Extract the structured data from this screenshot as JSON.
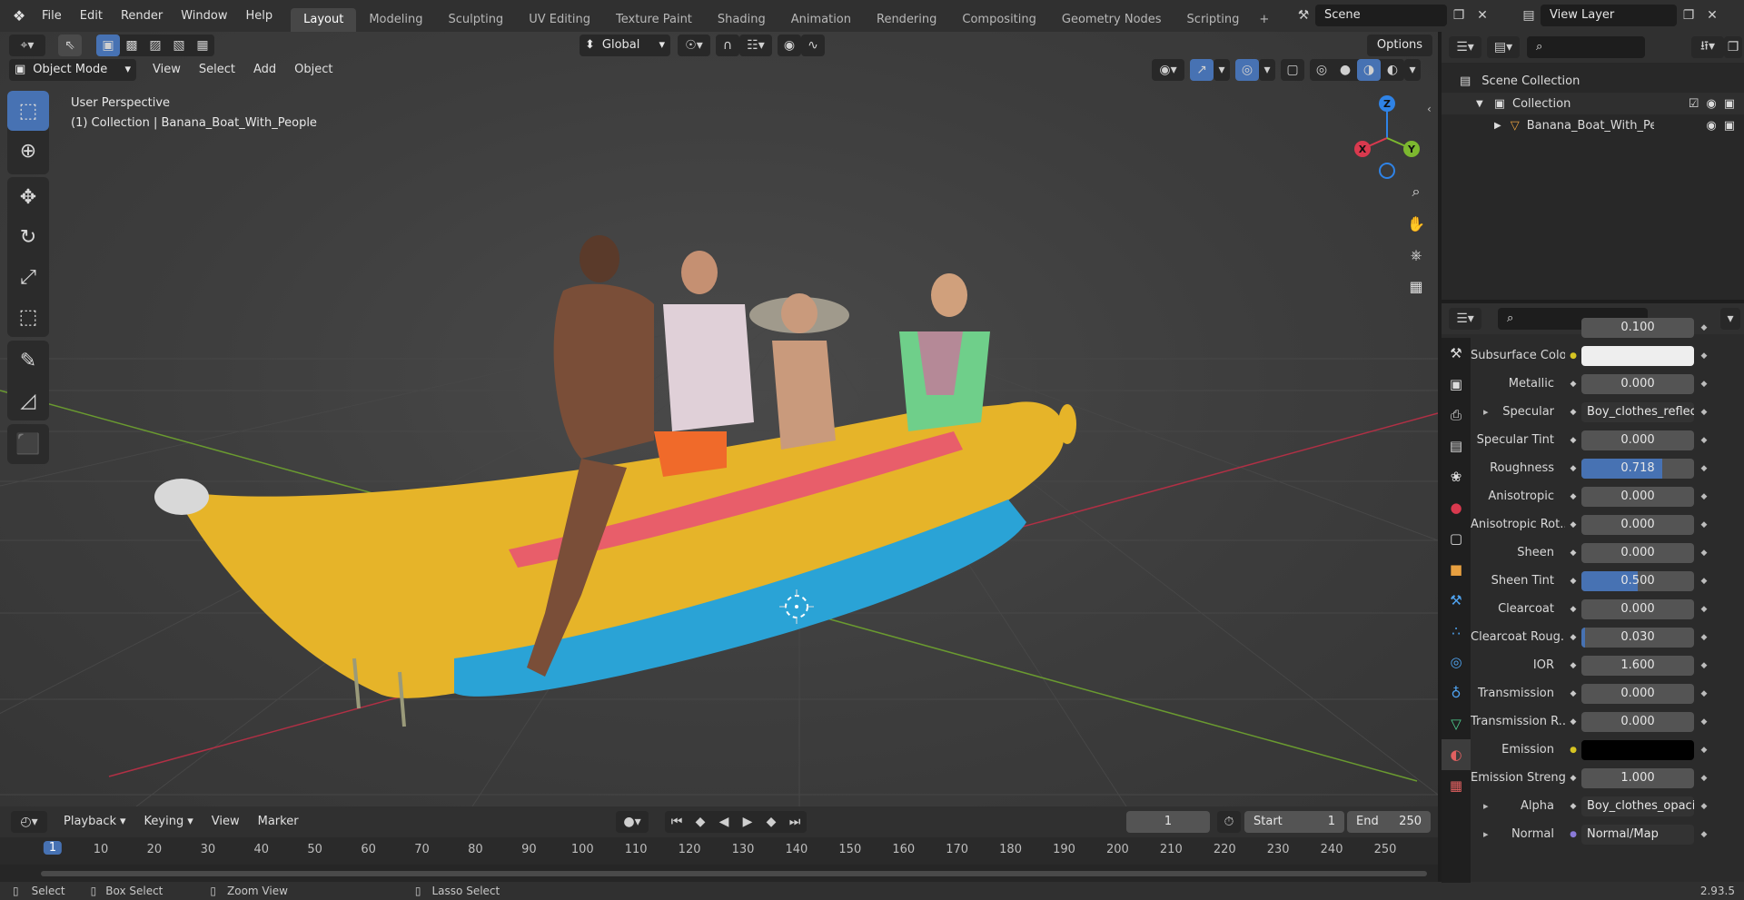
{
  "menubar": {
    "blender_icon": "blender-logo-icon",
    "items": [
      "File",
      "Edit",
      "Render",
      "Window",
      "Help"
    ],
    "workspaces": [
      "Layout",
      "Modeling",
      "Sculpting",
      "UV Editing",
      "Texture Paint",
      "Shading",
      "Animation",
      "Rendering",
      "Compositing",
      "Geometry Nodes",
      "Scripting"
    ],
    "active_workspace": "Layout",
    "add_tab": "+",
    "scene": "Scene",
    "view_layer": "View Layer"
  },
  "viewport": {
    "orientation": "Global",
    "options": "Options",
    "mode": "Object Mode",
    "menus": [
      "View",
      "Select",
      "Add",
      "Object"
    ],
    "perspective": "User Perspective",
    "collection_info": "(1) Collection | Banana_Boat_With_People",
    "gizmo": {
      "x": "X",
      "y": "Y",
      "z": "Z"
    }
  },
  "timeline": {
    "menus": [
      "Playback",
      "Keying",
      "View",
      "Marker"
    ],
    "current_frame": "1",
    "start_label": "Start",
    "start": "1",
    "end_label": "End",
    "end": "250",
    "ruler": [
      "1",
      "10",
      "20",
      "30",
      "40",
      "50",
      "60",
      "70",
      "80",
      "90",
      "100",
      "110",
      "120",
      "130",
      "140",
      "150",
      "160",
      "170",
      "180",
      "190",
      "200",
      "210",
      "220",
      "230",
      "240",
      "250"
    ]
  },
  "statusbar": {
    "select": "Select",
    "box_select": "Box Select",
    "zoom_view": "Zoom View",
    "lasso_select": "Lasso Select",
    "version": "2.93.5"
  },
  "outliner": {
    "root": "Scene Collection",
    "collection": "Collection",
    "object": "Banana_Boat_With_Peop"
  },
  "properties": {
    "top_value": "0.100",
    "rows": [
      {
        "label": "Subsurface Color",
        "type": "color",
        "color": "#eeeeee",
        "dot": "yellow"
      },
      {
        "label": "Metallic",
        "value": "0.000",
        "fill": 0
      },
      {
        "label": "Specular",
        "value": "Boy_clothes_reflecti...",
        "type": "link",
        "expand": true
      },
      {
        "label": "Specular Tint",
        "value": "0.000",
        "fill": 0
      },
      {
        "label": "Roughness",
        "value": "0.718",
        "fill": 0.718
      },
      {
        "label": "Anisotropic",
        "value": "0.000",
        "fill": 0
      },
      {
        "label": "Anisotropic Rot...",
        "value": "0.000",
        "fill": 0
      },
      {
        "label": "Sheen",
        "value": "0.000",
        "fill": 0
      },
      {
        "label": "Sheen Tint",
        "value": "0.500",
        "fill": 0.5
      },
      {
        "label": "Clearcoat",
        "value": "0.000",
        "fill": 0
      },
      {
        "label": "Clearcoat Roug...",
        "value": "0.030",
        "fill": 0.03
      },
      {
        "label": "IOR",
        "value": "1.600",
        "fill": 0
      },
      {
        "label": "Transmission",
        "value": "0.000",
        "fill": 0
      },
      {
        "label": "Transmission R...",
        "value": "0.000",
        "fill": 0
      },
      {
        "label": "Emission",
        "type": "color",
        "color": "#000000",
        "dot": "yellow"
      },
      {
        "label": "Emission Strengt",
        "value": "1.000",
        "fill": 0
      },
      {
        "label": "Alpha",
        "value": "Boy_clothes_opacity...",
        "type": "link",
        "expand": true
      },
      {
        "label": "Normal",
        "value": "Normal/Map",
        "type": "link",
        "expand": true,
        "dot": "purple"
      }
    ]
  },
  "colors": {
    "accent": "#4772b3",
    "x_axis": "#d9394e",
    "y_axis": "#7cb82f",
    "z_axis": "#2f83e6",
    "banana_yellow": "#e6b429",
    "boat_blue": "#2aa3d6"
  }
}
